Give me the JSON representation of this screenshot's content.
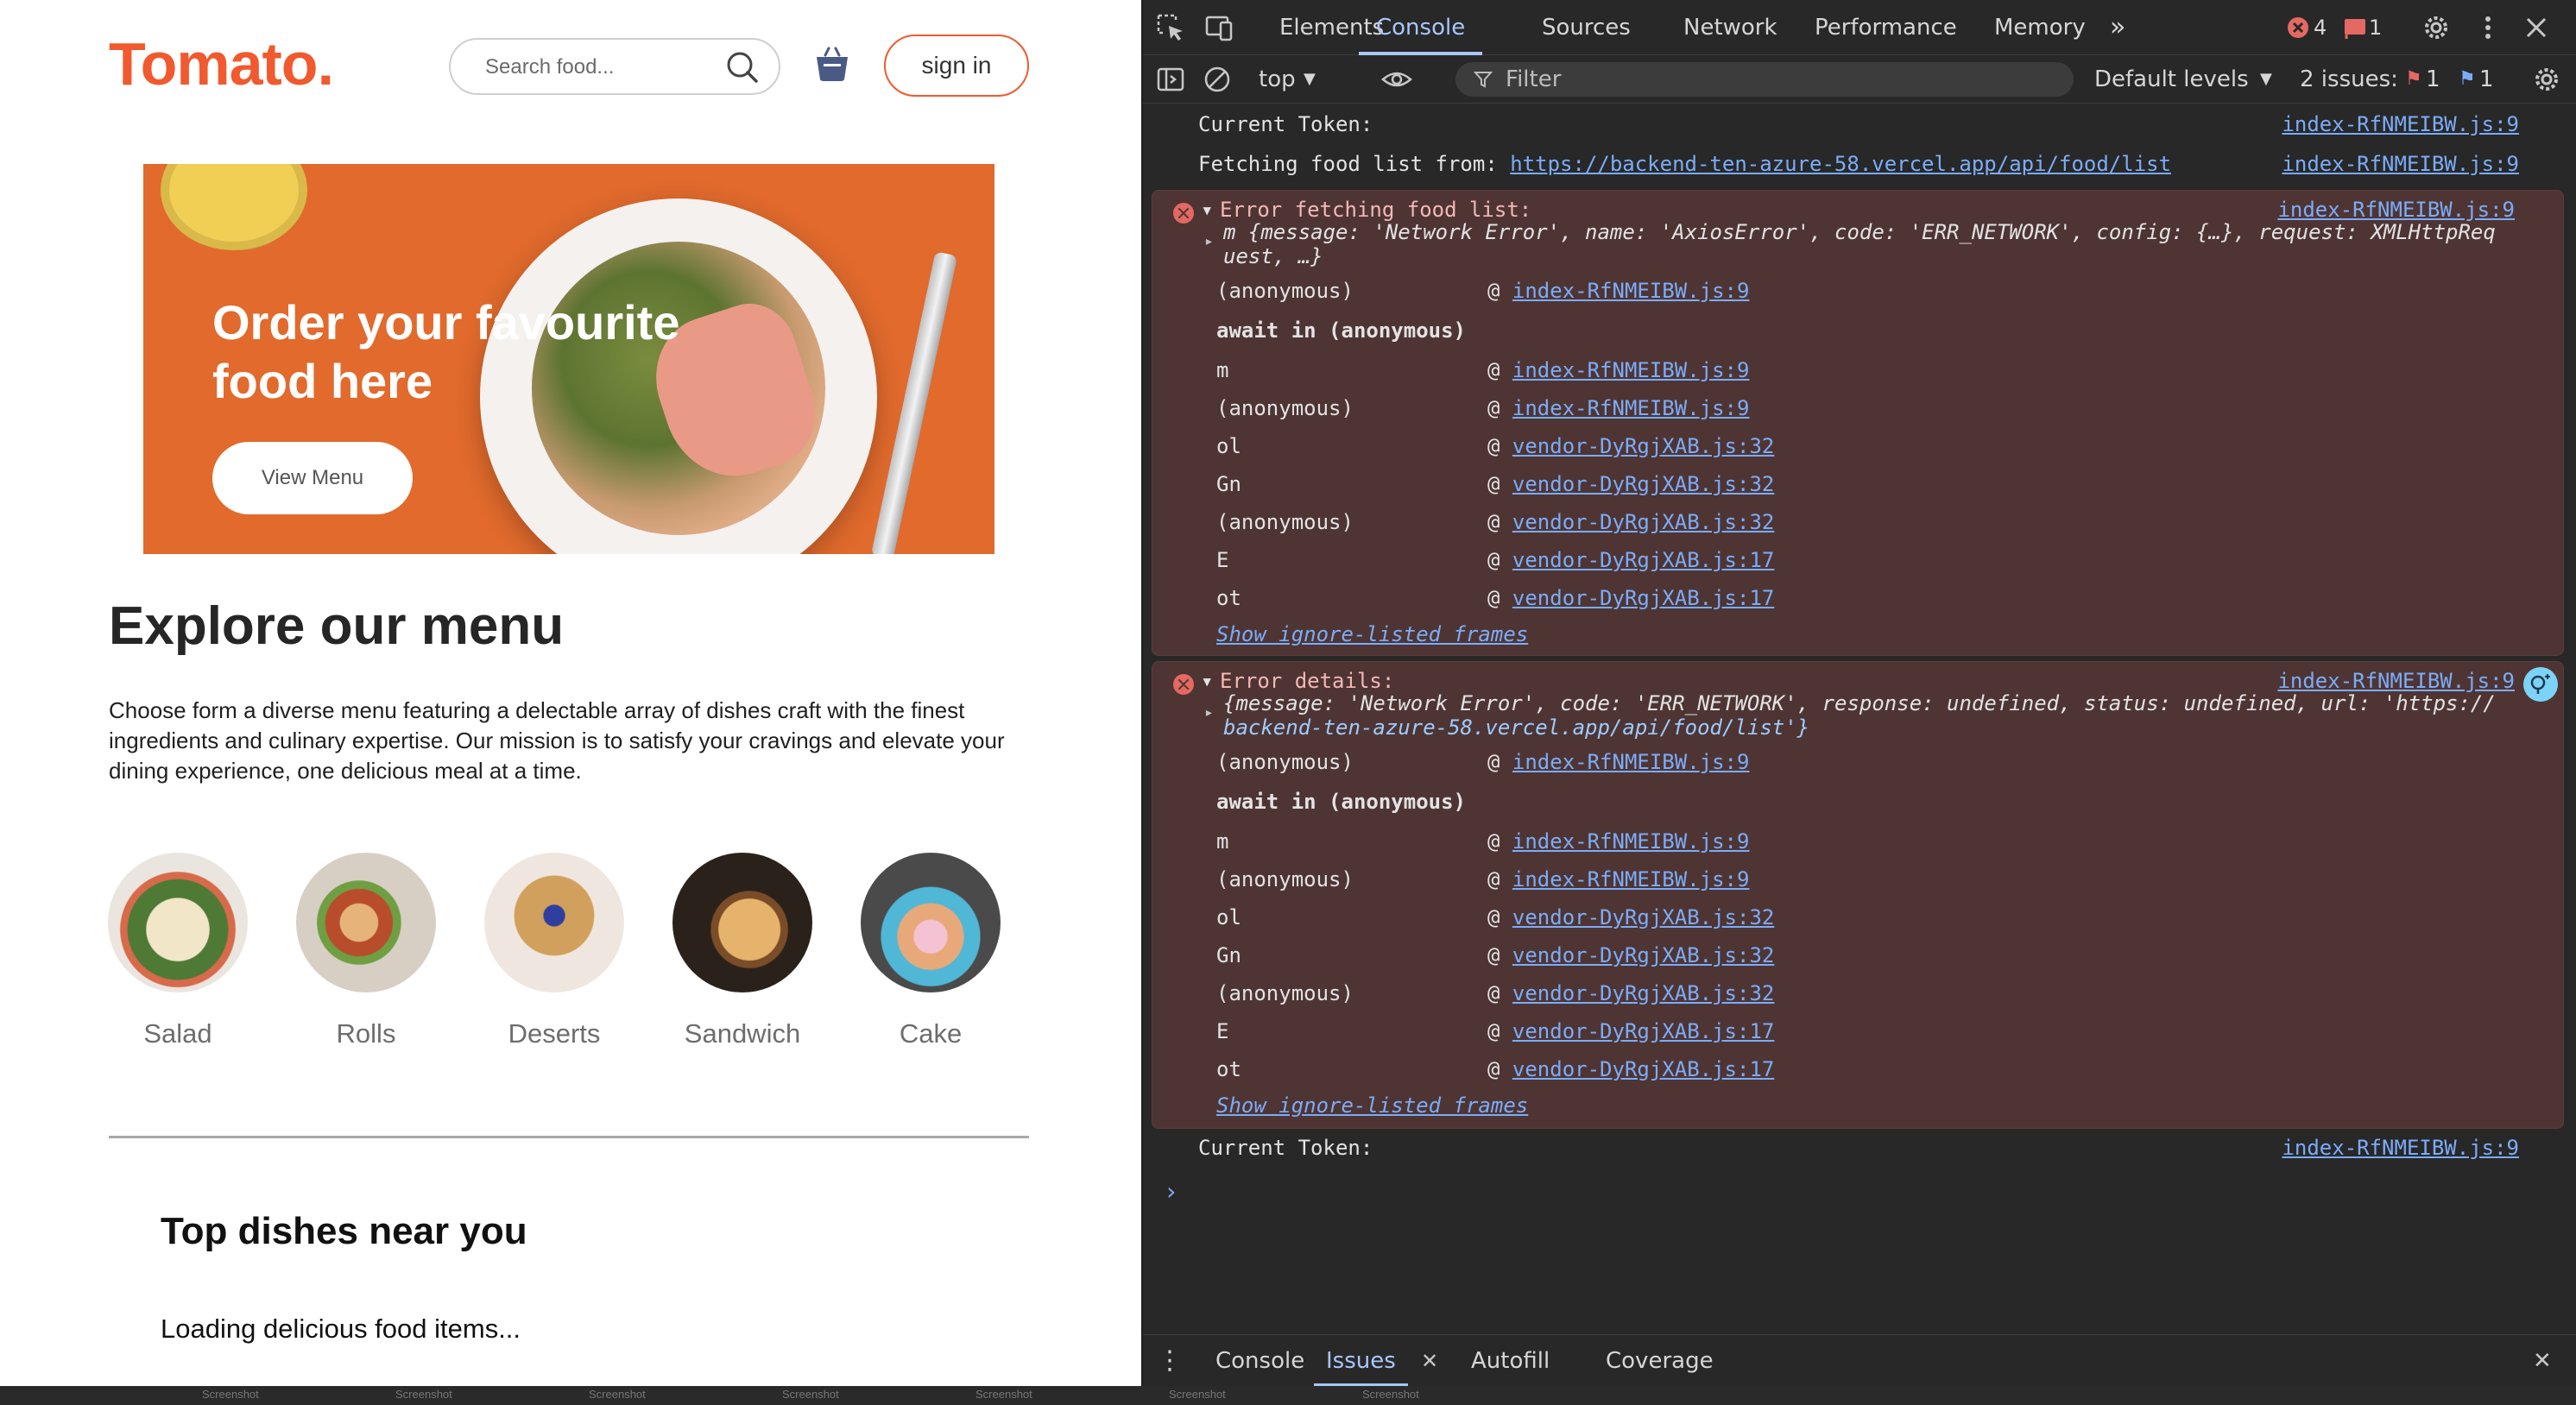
{
  "site": {
    "logo": "Tomato.",
    "search_placeholder": "Search food...",
    "signin_label": "sign in",
    "hero_heading": "Order your favourite food here",
    "hero_button": "View Menu",
    "explore_title": "Explore our menu",
    "explore_text": "Choose form a diverse menu featuring a delectable array of dishes craft with the finest ingredients and culinary expertise. Our mission is to satisfy your cravings and elevate your dining experience, one delicious meal at a time.",
    "menu": [
      "Salad",
      "Rolls",
      "Deserts",
      "Sandwich",
      "Cake"
    ],
    "top_dishes_title": "Top dishes near you",
    "loading_text": "Loading delicious food items...",
    "brand_color": "#f05a2e"
  },
  "devtools": {
    "tabs": [
      "Elements",
      "Console",
      "Sources",
      "Network",
      "Performance",
      "Memory"
    ],
    "active_tab": "Console",
    "error_count": "4",
    "issue_badge": "1",
    "context": "top",
    "filter_placeholder": "Filter",
    "levels": "Default levels",
    "issues_label": "2 issues:",
    "issues_errors": "1",
    "issues_info": "1",
    "console": {
      "line1_text": "Current Token:",
      "line1_src": "index-RfNMEIBW.js:9",
      "line2_prefix": "Fetching food list from: ",
      "line2_url": "https://backend-ten-azure-58.vercel.app/api/food/list",
      "line2_src": "index-RfNMEIBW.js:9",
      "err1_title": "Error fetching food list:",
      "err1_src": "index-RfNMEIBW.js:9",
      "err1_obj_1": "m {message: 'Network Error', name: 'AxiosError', code: 'ERR_NETWORK', config: {…}, request: XMLHttpReq",
      "err1_obj_2": "uest, …}",
      "err2_title": "Error details:",
      "err2_src": "index-RfNMEIBW.js:9",
      "err2_obj_1": "{message: 'Network Error', code: 'ERR_NETWORK', response: undefined, status: undefined, url: 'https://",
      "err2_obj_2": "backend-ten-azure-58.vercel.app/api/food/list'}",
      "await_label": "await in (anonymous)",
      "show_ignored": "Show ignore-listed frames",
      "stack": [
        {
          "fn": "(anonymous)",
          "src": "index-RfNMEIBW.js:9"
        },
        {
          "fn": "m",
          "src": "index-RfNMEIBW.js:9"
        },
        {
          "fn": "(anonymous)",
          "src": "index-RfNMEIBW.js:9"
        },
        {
          "fn": "ol",
          "src": "vendor-DyRgjXAB.js:32"
        },
        {
          "fn": "Gn",
          "src": "vendor-DyRgjXAB.js:32"
        },
        {
          "fn": "(anonymous)",
          "src": "vendor-DyRgjXAB.js:32"
        },
        {
          "fn": "E",
          "src": "vendor-DyRgjXAB.js:17"
        },
        {
          "fn": "ot",
          "src": "vendor-DyRgjXAB.js:17"
        }
      ],
      "line_last_text": "Current Token:",
      "line_last_src": "index-RfNMEIBW.js:9",
      "prompt": "›"
    },
    "drawer_tabs": [
      "Console",
      "Issues",
      "Autofill",
      "Coverage"
    ],
    "active_drawer_tab": "Issues"
  },
  "taskbar": [
    "Screenshot",
    "Screenshot",
    "Screenshot",
    "Screenshot",
    "Screenshot",
    "Screenshot",
    "Screenshot"
  ]
}
